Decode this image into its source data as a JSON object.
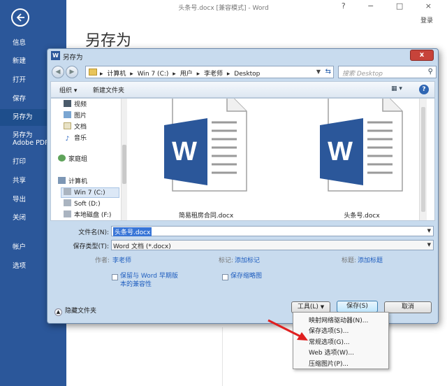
{
  "app": {
    "title": "头条号.docx [兼容模式] - Word",
    "login": "登录",
    "window_controls": "? − □ ×",
    "page_heading": "另存为",
    "brand_color": "#2b579a"
  },
  "backstage_nav": {
    "items": [
      {
        "label": "信息"
      },
      {
        "label": "新建"
      },
      {
        "label": "打开"
      },
      {
        "label": "保存"
      },
      {
        "label": "另存为"
      },
      {
        "label": "另存为 Adobe PDF"
      },
      {
        "label": "打印"
      },
      {
        "label": "共享"
      },
      {
        "label": "导出"
      },
      {
        "label": "关闭"
      },
      {
        "label": "帐户"
      },
      {
        "label": "选项"
      }
    ],
    "active": "另存为"
  },
  "dialog": {
    "title": "另存为",
    "close": "x",
    "address": {
      "crumbs": [
        "计算机",
        "Win 7 (C:)",
        "用户",
        "李老师",
        "Desktop"
      ],
      "separator": "▸"
    },
    "search": {
      "placeholder": "搜索 Desktop"
    },
    "toolbar": {
      "organize": "组织 ▾",
      "new_folder": "新建文件夹"
    },
    "sidebar": [
      {
        "label": "视频",
        "icon": "video-icon"
      },
      {
        "label": "图片",
        "icon": "picture-icon"
      },
      {
        "label": "文档",
        "icon": "document-icon"
      },
      {
        "label": "音乐",
        "icon": "music-icon"
      },
      {
        "label": "家庭组",
        "icon": "homegroup-icon"
      },
      {
        "label": "计算机",
        "icon": "computer-icon"
      },
      {
        "label": "Win 7 (C:)",
        "icon": "drive-icon"
      },
      {
        "label": "Soft (D:)",
        "icon": "drive-icon"
      },
      {
        "label": "本地磁盘 (F:)",
        "icon": "drive-icon"
      }
    ],
    "files": [
      {
        "name": "简易租房合同.docx"
      },
      {
        "name": "头条号.docx"
      }
    ],
    "filename_label": "文件名(N):",
    "filename_value": "头条号.docx",
    "savetype_label": "保存类型(T):",
    "savetype_value": "Word 文档 (*.docx)",
    "author_label": "作者:",
    "author_value": "李老师",
    "tags_label": "标记:",
    "tags_value": "添加标记",
    "title_label": "标题:",
    "title_value": "添加标题",
    "compat_line1": "保留与 Word 早期版",
    "compat_line2": "本的兼容性",
    "thumbnail": "保存缩略图",
    "hide_folders": "隐藏文件夹",
    "tools_btn": "工具(L)",
    "save_btn": "保存(S)",
    "cancel_btn": "取消"
  },
  "tools_menu": {
    "items": [
      {
        "label": "映射网络驱动器(N)..."
      },
      {
        "label": "保存选项(S)..."
      },
      {
        "label": "常规选项(G)..."
      },
      {
        "label": "Web 选项(W)..."
      },
      {
        "label": "压缩图片(P)..."
      }
    ]
  }
}
